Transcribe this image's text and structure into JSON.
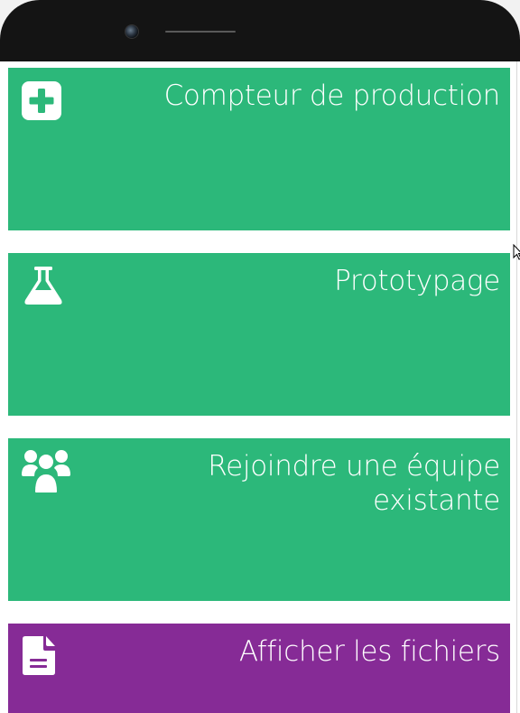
{
  "tiles": [
    {
      "label": "Compteur de production",
      "icon": "plus-square-icon",
      "color": "#2cb87a"
    },
    {
      "label": "Prototypage",
      "icon": "flask-icon",
      "color": "#2cb87a"
    },
    {
      "label": "Rejoindre une équipe existante",
      "icon": "users-icon",
      "color": "#2cb87a"
    },
    {
      "label": "Afficher les fichiers",
      "icon": "file-text-icon",
      "color": "#862b96"
    }
  ]
}
